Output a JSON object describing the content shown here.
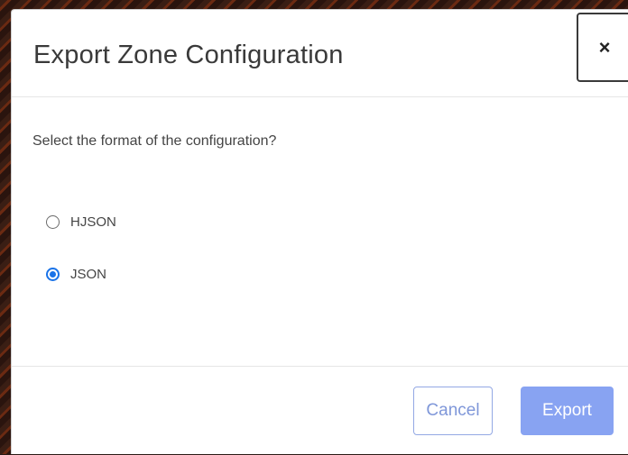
{
  "dialog": {
    "title": "Export Zone Configuration",
    "close_label": "×"
  },
  "body": {
    "question": "Select the format of the configuration?",
    "options": [
      {
        "label": "HJSON",
        "selected": false
      },
      {
        "label": "JSON",
        "selected": true
      }
    ]
  },
  "footer": {
    "cancel_label": "Cancel",
    "export_label": "Export"
  },
  "colors": {
    "accent": "#1a73e8",
    "primary_button": "#88a3f2",
    "outline_button": "#93a8e4"
  }
}
